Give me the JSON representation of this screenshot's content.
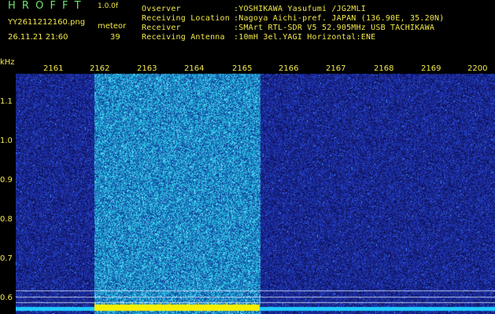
{
  "header": {
    "app_name": "H R O F F T",
    "version": "1.0.0f",
    "filename": "YY2611212160.png",
    "datetime": "26.11.21 21:60",
    "event_label": "meteor",
    "event_count": "39"
  },
  "station": {
    "observer_label": "Ovserver",
    "observer_value": ":YOSHIKAWA Yasufumi /JG2MLI",
    "location_label": "Receiving Location",
    "location_value": ":Nagoya Aichi-pref. JAPAN (136.90E, 35.20N)",
    "receiver_label": "Receiver",
    "receiver_value": ":SMArt RTL-SDR V5 52.905MHz USB TACHIKAWA",
    "antenna_label": "Receiving Antenna",
    "antenna_value": ":10mH 3el.YAGI Horizontal:ENE"
  },
  "axis": {
    "unit": "kHz",
    "y_ticks": [
      "1.1",
      "1.0",
      "0.9",
      "0.8",
      "0.7",
      "0.6"
    ],
    "x_ticks": [
      "2161",
      "2162",
      "2163",
      "2164",
      "2165",
      "2166",
      "2167",
      "2168",
      "2169",
      "2200"
    ]
  },
  "colors": {
    "background": "#0a0a3a",
    "noise_low": "#13137a",
    "noise_high": "#2a4dff",
    "bright_band": "#2c6cff",
    "signal_line": "#1ec9ff",
    "burst": "#f5f000",
    "header_green": "#6fe36f",
    "header_yellow": "#f2e84a"
  }
}
